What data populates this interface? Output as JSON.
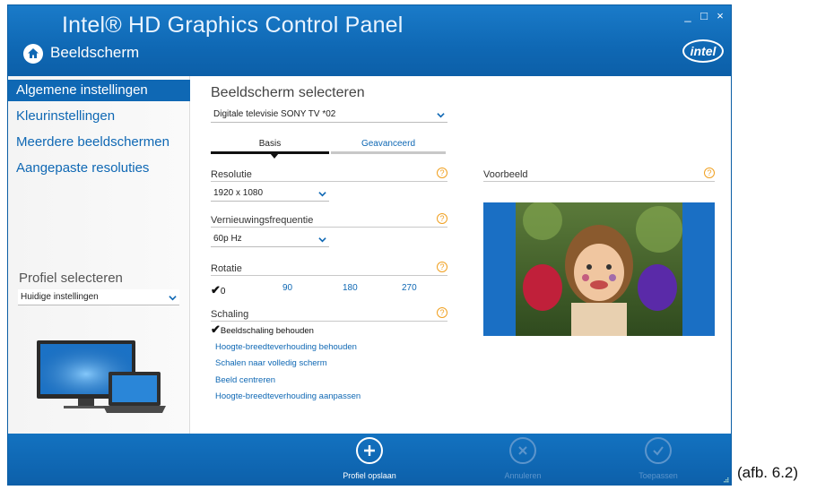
{
  "window": {
    "app_title": "Intel® HD Graphics Control Panel",
    "section_title": "Beeldscherm",
    "controls": {
      "minimize": "_",
      "maximize": "□",
      "close": "×"
    },
    "logo_text": "intel"
  },
  "sidebar": {
    "items": [
      {
        "label": "Algemene instellingen",
        "active": true
      },
      {
        "label": "Kleurinstellingen",
        "active": false
      },
      {
        "label": "Meerdere beeldschermen",
        "active": false
      },
      {
        "label": "Aangepaste resoluties",
        "active": false
      }
    ],
    "profile_label": "Profiel selecteren",
    "profile_value": "Huidige instellingen"
  },
  "main": {
    "display_title": "Beeldscherm selecteren",
    "display_value": "Digitale televisie SONY TV  *02",
    "tabs": [
      {
        "label": "Basis",
        "active": true
      },
      {
        "label": "Geavanceerd",
        "active": false
      }
    ],
    "resolution": {
      "label": "Resolutie",
      "value": "1920 x 1080"
    },
    "refresh": {
      "label": "Vernieuwingsfrequentie",
      "value": "60p Hz"
    },
    "rotation": {
      "label": "Rotatie",
      "options": [
        "0",
        "90",
        "180",
        "270"
      ],
      "selected": "0"
    },
    "scaling": {
      "label": "Schaling",
      "selected": "Beeldschaling behouden",
      "options": [
        "Hoogte-breedteverhouding behouden",
        "Schalen naar volledig scherm",
        "Beeld centreren",
        "Hoogte-breedteverhouding aanpassen"
      ]
    },
    "preview": {
      "label": "Voorbeeld"
    },
    "help_glyph": "?"
  },
  "footer": {
    "save": "Profiel opslaan",
    "cancel": "Annuleren",
    "apply": "Toepassen"
  },
  "caption": "(afb. 6.2)",
  "colors": {
    "brand_blue": "#0f68b4",
    "help_orange": "#f0a020"
  }
}
